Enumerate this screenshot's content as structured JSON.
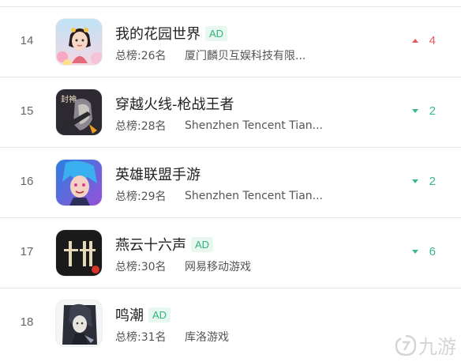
{
  "rows": [
    {
      "rank": "14",
      "name": "我的花园世界",
      "ad": "AD",
      "total": "总榜:26名",
      "developer": "厦门麟贝互娱科技有限...",
      "change": "4",
      "direction": "up",
      "icon": "garden-game-icon"
    },
    {
      "rank": "15",
      "name": "穿越火线-枪战王者",
      "ad": "",
      "total": "总榜:28名",
      "developer": "Shenzhen Tencent Tian...",
      "change": "2",
      "direction": "down",
      "icon": "crossfire-icon"
    },
    {
      "rank": "16",
      "name": "英雄联盟手游",
      "ad": "",
      "total": "总榜:29名",
      "developer": "Shenzhen Tencent Tian...",
      "change": "2",
      "direction": "down",
      "icon": "league-icon"
    },
    {
      "rank": "17",
      "name": "燕云十六声",
      "ad": "AD",
      "total": "总榜:30名",
      "developer": "网易移动游戏",
      "change": "6",
      "direction": "down",
      "icon": "yanyun-icon"
    },
    {
      "rank": "18",
      "name": "鸣潮",
      "ad": "AD",
      "total": "总榜:31名",
      "developer": "库洛游戏",
      "change": "",
      "direction": "none",
      "icon": "wuthering-icon"
    }
  ],
  "watermark": {
    "text": "九游",
    "icon": "jiuyou-logo-icon"
  },
  "colors": {
    "up": "#e85a5a",
    "down": "#3cb88a",
    "ad_text": "#2fb47c",
    "ad_bg": "#e8f7ef"
  }
}
